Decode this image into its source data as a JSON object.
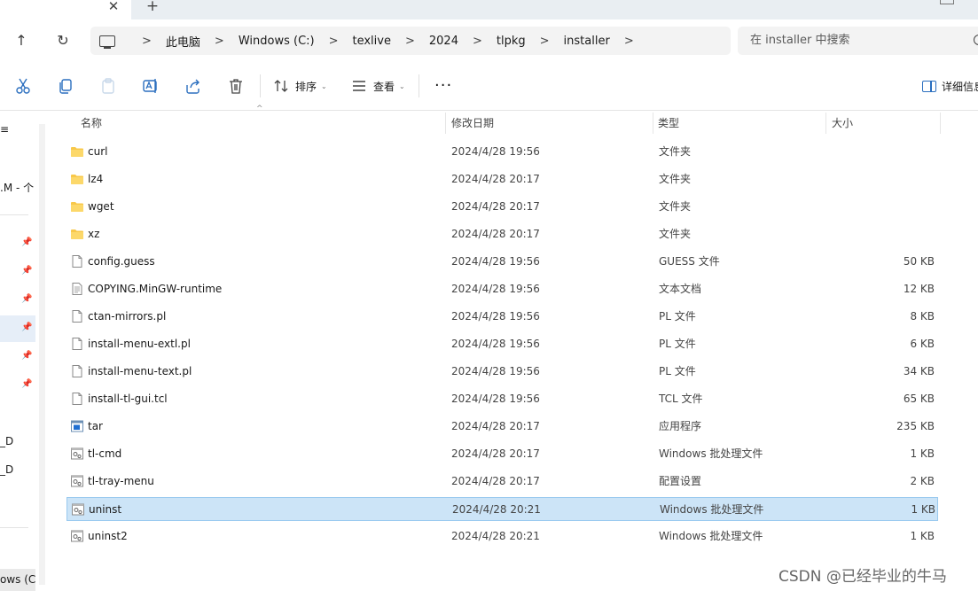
{
  "tab": {
    "close": "✕",
    "new": "+"
  },
  "nav": {
    "up": "↑",
    "refresh": "↻"
  },
  "breadcrumb": [
    "此电脑",
    "Windows (C:)",
    "texlive",
    "2024",
    "tlpkg",
    "installer"
  ],
  "breadcrumb_sep": ">",
  "search": {
    "placeholder": "在 installer 中搜索"
  },
  "commands": {
    "sort": "排序",
    "view": "查看",
    "more": "···",
    "details": "详细信息"
  },
  "columns": {
    "name": "名称",
    "modified": "修改日期",
    "type": "类型",
    "size": "大小"
  },
  "sidebar": {
    "fragments": [
      "≡",
      ".M - 个",
      "_D",
      "_D"
    ],
    "bottom": "ows (C:)"
  },
  "files": [
    {
      "name": "curl",
      "modified": "2024/4/28 19:56",
      "type": "文件夹",
      "size": "",
      "icon": "folder-icon"
    },
    {
      "name": "lz4",
      "modified": "2024/4/28 20:17",
      "type": "文件夹",
      "size": "",
      "icon": "folder-icon"
    },
    {
      "name": "wget",
      "modified": "2024/4/28 20:17",
      "type": "文件夹",
      "size": "",
      "icon": "folder-icon"
    },
    {
      "name": "xz",
      "modified": "2024/4/28 20:17",
      "type": "文件夹",
      "size": "",
      "icon": "folder-icon"
    },
    {
      "name": "config.guess",
      "modified": "2024/4/28 19:56",
      "type": "GUESS 文件",
      "size": "50 KB",
      "icon": "file-icon"
    },
    {
      "name": "COPYING.MinGW-runtime",
      "modified": "2024/4/28 19:56",
      "type": "文本文档",
      "size": "12 KB",
      "icon": "text-file-icon"
    },
    {
      "name": "ctan-mirrors.pl",
      "modified": "2024/4/28 19:56",
      "type": "PL 文件",
      "size": "8 KB",
      "icon": "file-icon"
    },
    {
      "name": "install-menu-extl.pl",
      "modified": "2024/4/28 19:56",
      "type": "PL 文件",
      "size": "6 KB",
      "icon": "file-icon"
    },
    {
      "name": "install-menu-text.pl",
      "modified": "2024/4/28 19:56",
      "type": "PL 文件",
      "size": "34 KB",
      "icon": "file-icon"
    },
    {
      "name": "install-tl-gui.tcl",
      "modified": "2024/4/28 19:56",
      "type": "TCL 文件",
      "size": "65 KB",
      "icon": "file-icon"
    },
    {
      "name": "tar",
      "modified": "2024/4/28 20:17",
      "type": "应用程序",
      "size": "235 KB",
      "icon": "exe-icon"
    },
    {
      "name": "tl-cmd",
      "modified": "2024/4/28 20:17",
      "type": "Windows 批处理文件",
      "size": "1 KB",
      "icon": "batch-file-icon"
    },
    {
      "name": "tl-tray-menu",
      "modified": "2024/4/28 20:17",
      "type": "配置设置",
      "size": "2 KB",
      "icon": "config-file-icon"
    },
    {
      "name": "uninst",
      "modified": "2024/4/28 20:21",
      "type": "Windows 批处理文件",
      "size": "1 KB",
      "icon": "batch-file-icon",
      "selected": true
    },
    {
      "name": "uninst2",
      "modified": "2024/4/28 20:21",
      "type": "Windows 批处理文件",
      "size": "1 KB",
      "icon": "batch-file-icon"
    }
  ],
  "watermark": "CSDN @已经毕业的牛马",
  "colors": {
    "selection": "#cce4f7",
    "selection_border": "#99c9ef",
    "folder": "#f8c84a",
    "accent": "#2b6fbf"
  }
}
